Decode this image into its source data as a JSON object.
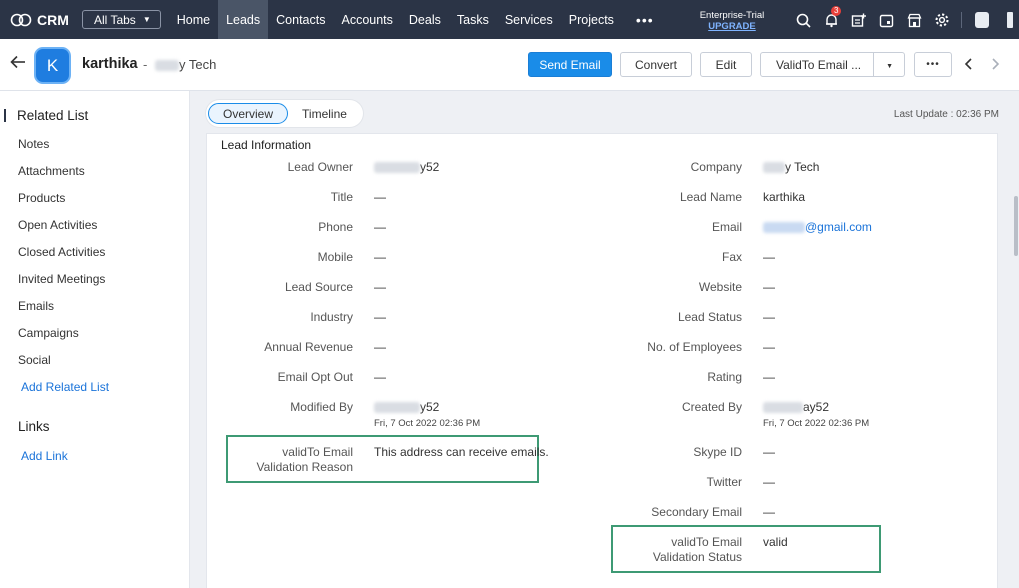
{
  "topnav": {
    "brand": "CRM",
    "all_tabs": "All Tabs",
    "links": [
      "Home",
      "Leads",
      "Contacts",
      "Accounts",
      "Deals",
      "Tasks",
      "Services",
      "Projects"
    ],
    "active_link": "Leads",
    "more": "•••",
    "trial_label": "Enterprise-Trial",
    "upgrade": "UPGRADE",
    "notification_count": "3"
  },
  "record": {
    "initial": "K",
    "name": "karthika",
    "separator": "-",
    "company_suffix": "y Tech",
    "buttons": {
      "send_email": "Send Email",
      "convert": "Convert",
      "edit": "Edit",
      "validto": "ValidTo Email ...",
      "more": "•••"
    }
  },
  "sidebar": {
    "related_title": "Related List",
    "items": [
      "Notes",
      "Attachments",
      "Products",
      "Open Activities",
      "Closed Activities",
      "Invited Meetings",
      "Emails",
      "Campaigns",
      "Social"
    ],
    "add_related": "Add Related List",
    "links_title": "Links",
    "add_link": "Add Link"
  },
  "main": {
    "tabs": [
      "Overview",
      "Timeline"
    ],
    "last_update": "Last Update : 02:36 PM",
    "section_title": "Lead Information"
  },
  "fields_left": [
    {
      "label": "Lead Owner",
      "value": "y52"
    },
    {
      "label": "Title",
      "value": "—"
    },
    {
      "label": "Phone",
      "value": "—"
    },
    {
      "label": "Mobile",
      "value": "—"
    },
    {
      "label": "Lead Source",
      "value": "—"
    },
    {
      "label": "Industry",
      "value": "—"
    },
    {
      "label": "Annual Revenue",
      "value": "—"
    },
    {
      "label": "Email Opt Out",
      "value": "—"
    },
    {
      "label": "Modified By",
      "value": "y52",
      "sub": "Fri, 7 Oct 2022 02:36 PM"
    },
    {
      "label": "validTo Email Validation Reason",
      "value": "This address can receive emails."
    }
  ],
  "fields_right": [
    {
      "label": "Company",
      "value": "y Tech"
    },
    {
      "label": "Lead Name",
      "value": "karthika"
    },
    {
      "label": "Email",
      "value": "@gmail.com"
    },
    {
      "label": "Fax",
      "value": "—"
    },
    {
      "label": "Website",
      "value": "—"
    },
    {
      "label": "Lead Status",
      "value": "—"
    },
    {
      "label": "No. of Employees",
      "value": "—"
    },
    {
      "label": "Rating",
      "value": "—"
    },
    {
      "label": "Created By",
      "value": "ay52",
      "sub": "Fri, 7 Oct 2022 02:36 PM"
    },
    {
      "label": "Skype ID",
      "value": "—"
    },
    {
      "label": "Twitter",
      "value": "—"
    },
    {
      "label": "Secondary Email",
      "value": "—"
    },
    {
      "label": "validTo Email Validation Status",
      "value": "valid"
    }
  ],
  "colors": {
    "nav_bg": "#2b3446",
    "primary": "#1a8ce8",
    "highlight_box": "#3e9a74",
    "link": "#1a73d9"
  }
}
